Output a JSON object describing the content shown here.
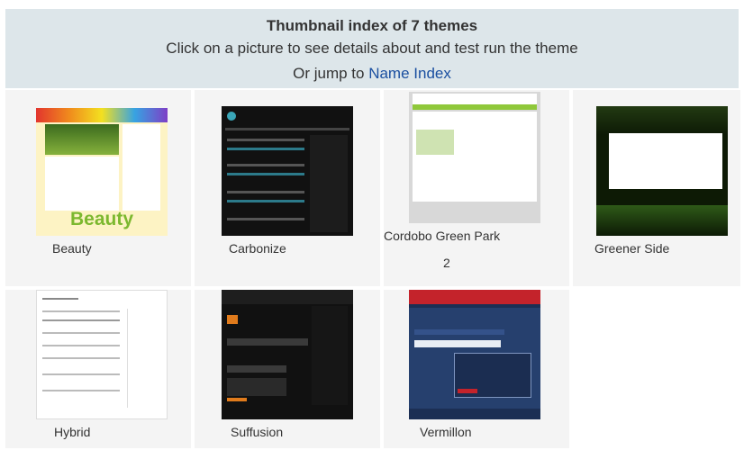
{
  "header": {
    "title": "Thumbnail index of 7 themes",
    "line1": "Click on a picture to see details about and test run the theme",
    "line2_prefix": "Or jump to ",
    "line2_link": "Name Index"
  },
  "themes": [
    {
      "name": "Beauty",
      "thumb_text": "Beauty",
      "icon": "beauty-theme-thumbnail"
    },
    {
      "name": "Carbonize",
      "icon": "carbonize-theme-thumbnail"
    },
    {
      "name": "Cordobo Green Park",
      "name_line2": "2",
      "icon": "cordobo-theme-thumbnail"
    },
    {
      "name": "Greener Side",
      "icon": "greener-side-theme-thumbnail"
    },
    {
      "name": "Hybrid",
      "icon": "hybrid-theme-thumbnail"
    },
    {
      "name": "Suffusion",
      "icon": "suffusion-theme-thumbnail"
    },
    {
      "name": "Vermillon",
      "icon": "vermillon-theme-thumbnail"
    }
  ],
  "colors": {
    "header_bg": "#dde6ea",
    "cell_bg": "#f4f4f4",
    "link": "#1a4fa0"
  }
}
